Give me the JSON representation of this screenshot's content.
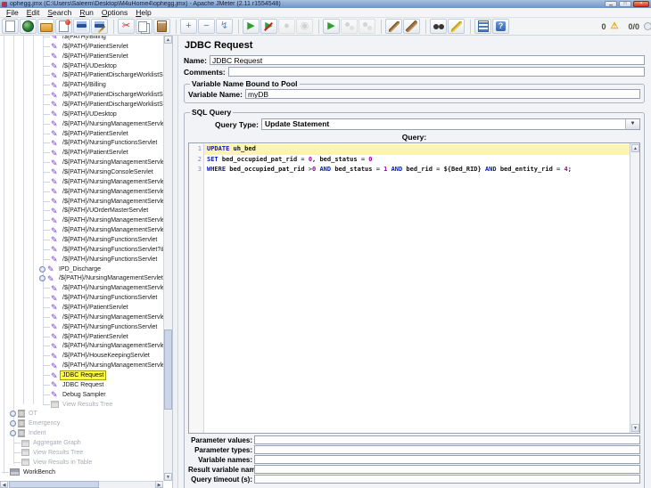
{
  "window": {
    "title": "ophegg.jmx (C:\\Users\\Saleem\\Desktop\\M4uHome4\\ophegg.jmx) - Apache JMeter (2.11 r1554548)",
    "controls": [
      {
        "name": "minimize",
        "glyph": "▁"
      },
      {
        "name": "maximize",
        "glyph": "□"
      },
      {
        "name": "close",
        "glyph": "×"
      }
    ]
  },
  "menu": {
    "items": [
      "File",
      "Edit",
      "Search",
      "Run",
      "Options",
      "Help"
    ]
  },
  "toolbar": {
    "groups": [
      [
        {
          "name": "new-file"
        },
        {
          "name": "templates"
        },
        {
          "name": "open-folder"
        },
        {
          "name": "close-file"
        },
        {
          "name": "save"
        },
        {
          "name": "save-as"
        }
      ],
      [
        {
          "name": "cut",
          "glyph": "✂",
          "color": "#cc2020"
        },
        {
          "name": "copy"
        },
        {
          "name": "paste"
        }
      ],
      [
        {
          "name": "expand-all",
          "glyph": "+",
          "color": "#4878c8"
        },
        {
          "name": "collapse-all",
          "glyph": "−",
          "color": "#4878c8"
        },
        {
          "name": "toggle",
          "glyph": "↯",
          "color": "#6888c8"
        }
      ],
      [
        {
          "name": "start",
          "glyph": "▶",
          "color": "#2ca02c"
        },
        {
          "name": "start-no-pauses",
          "glyph": "▶",
          "color": "#2ca02c"
        },
        {
          "name": "stop",
          "glyph": "●",
          "color": "#b0b0b0",
          "disabled": true
        },
        {
          "name": "shutdown",
          "glyph": "◉",
          "color": "#b0b0b0",
          "disabled": true
        }
      ],
      [
        {
          "name": "remote-start",
          "glyph": "▶",
          "color": "#2ca02c"
        },
        {
          "name": "remote-start-all",
          "disabled": true
        },
        {
          "name": "remote-stop",
          "disabled": true
        }
      ],
      [
        {
          "name": "clear"
        },
        {
          "name": "clear-all"
        }
      ],
      [
        {
          "name": "search"
        },
        {
          "name": "search-reset"
        }
      ],
      [
        {
          "name": "function-helper"
        },
        {
          "name": "help"
        }
      ]
    ],
    "status": {
      "errors": "0",
      "warn_icon": "⚠",
      "threads": "0/0"
    }
  },
  "tree": {
    "items": [
      {
        "label": "/${PATH}/Billing",
        "type": "sampler",
        "indent": 57
      },
      {
        "label": "/${PATH}/PatientServlet",
        "type": "sampler",
        "indent": 57
      },
      {
        "label": "/${PATH}/PatientServlet",
        "type": "sampler",
        "indent": 57
      },
      {
        "label": "/${PATH}/UDesktop",
        "type": "sampler",
        "indent": 57
      },
      {
        "label": "/${PATH}/PatientDischargeWorklistServlet",
        "type": "sampler",
        "indent": 57
      },
      {
        "label": "/${PATH}/Billing",
        "type": "sampler",
        "indent": 57
      },
      {
        "label": "/${PATH}/PatientDischargeWorklistServlet",
        "type": "sampler",
        "indent": 57
      },
      {
        "label": "/${PATH}/PatientDischargeWorklistServlet",
        "type": "sampler",
        "indent": 57
      },
      {
        "label": "/${PATH}/UDesktop",
        "type": "sampler",
        "indent": 57
      },
      {
        "label": "/${PATH}/NursingManagementServlet",
        "type": "sampler",
        "indent": 57
      },
      {
        "label": "/${PATH}/PatientServlet",
        "type": "sampler",
        "indent": 57
      },
      {
        "label": "/${PATH}/NursingFunctionsServlet",
        "type": "sampler",
        "indent": 57
      },
      {
        "label": "/${PATH}/PatientServlet",
        "type": "sampler",
        "indent": 57
      },
      {
        "label": "/${PATH}/NursingManagementServlet",
        "type": "sampler",
        "indent": 57
      },
      {
        "label": "/${PATH}/NursingConsoleServlet",
        "type": "sampler",
        "indent": 57
      },
      {
        "label": "/${PATH}/NursingManagementServlet",
        "type": "sampler",
        "indent": 57
      },
      {
        "label": "/${PATH}/NursingManagementServlet",
        "type": "sampler",
        "indent": 57
      },
      {
        "label": "/${PATH}/NursingManagementServlet",
        "type": "sampler",
        "indent": 57
      },
      {
        "label": "/${PATH}/UOrderMasterServlet",
        "type": "sampler",
        "indent": 57
      },
      {
        "label": "/${PATH}/NursingManagementServlet",
        "type": "sampler",
        "indent": 57
      },
      {
        "label": "/${PATH}/NursingManagementServlet",
        "type": "sampler",
        "indent": 57
      },
      {
        "label": "/${PATH}/NursingFunctionsServlet",
        "type": "sampler",
        "indent": 57
      },
      {
        "label": "/${PATH}/NursingFunctionsServlet?&use",
        "type": "sampler",
        "indent": 57
      },
      {
        "label": "/${PATH}/NursingFunctionsServlet",
        "type": "sampler",
        "indent": 57
      },
      {
        "label": "IPD_Discharge",
        "type": "sampler",
        "indent": 57,
        "handle": true
      },
      {
        "label": "/${PATH}/NursingManagementServlet",
        "type": "sampler",
        "indent": 57,
        "handle": true
      },
      {
        "label": "/${PATH}/NursingManagementServlet",
        "type": "sampler",
        "indent": 57
      },
      {
        "label": "/${PATH}/NursingFunctionsServlet",
        "type": "sampler",
        "indent": 57
      },
      {
        "label": "/${PATH}/PatientServlet",
        "type": "sampler",
        "indent": 57
      },
      {
        "label": "/${PATH}/NursingManagementServlet",
        "type": "sampler",
        "indent": 57
      },
      {
        "label": "/${PATH}/NursingFunctionsServlet",
        "type": "sampler",
        "indent": 57
      },
      {
        "label": "/${PATH}/PatientServlet",
        "type": "sampler",
        "indent": 57
      },
      {
        "label": "/${PATH}/NursingManagementServlet",
        "type": "sampler",
        "indent": 57
      },
      {
        "label": "/${PATH}/HouseKeepingServlet",
        "type": "sampler",
        "indent": 57
      },
      {
        "label": "/${PATH}/NursingManagementServlet",
        "type": "sampler",
        "indent": 57
      },
      {
        "label": "JDBC Request",
        "type": "sampler",
        "indent": 57,
        "selected": true
      },
      {
        "label": "JDBC Request",
        "type": "sampler",
        "indent": 57
      },
      {
        "label": "Debug Sampler",
        "type": "sampler",
        "indent": 57
      },
      {
        "label": "View Results Tree",
        "type": "listener",
        "indent": 57,
        "disabled": true
      },
      {
        "label": "OT",
        "type": "threadgroup",
        "indent": 24,
        "handle": true,
        "disabled": true
      },
      {
        "label": "Emergency",
        "type": "threadgroup",
        "indent": 24,
        "handle": true,
        "disabled": true
      },
      {
        "label": "Indent",
        "type": "threadgroup",
        "indent": 24,
        "handle": true,
        "disabled": true
      },
      {
        "label": "Aggregate Graph",
        "type": "listener",
        "indent": 24,
        "disabled": true
      },
      {
        "label": "View Results Tree",
        "type": "listener",
        "indent": 24,
        "disabled": true
      },
      {
        "label": "View Results in Table",
        "type": "listener",
        "indent": 24,
        "disabled": true
      },
      {
        "label": "WorkBench",
        "type": "workbench",
        "indent": 11
      }
    ]
  },
  "panel": {
    "title": "JDBC Request",
    "name_label": "Name:",
    "name_value": "JDBC Request",
    "comments_label": "Comments:",
    "comments_value": "",
    "pool_group": {
      "title": "Variable Name Bound to Pool",
      "var_label": "Variable Name:",
      "var_value": "myDB"
    },
    "sql_group": {
      "title": "SQL Query",
      "query_type_label": "Query Type:",
      "query_type_value": "Update Statement",
      "query_label": "Query:",
      "syntax_colors": {
        "keyword": "#0018c8",
        "number": "#a000a0",
        "plain": "#101010"
      },
      "active_line_color": "#fcf5b2",
      "sql_lines": [
        {
          "num": 1,
          "active": true,
          "tokens": [
            [
              "kw",
              "UPDATE"
            ],
            [
              "pl",
              " uh_bed"
            ]
          ]
        },
        {
          "num": 2,
          "tokens": [
            [
              "kw",
              "SET"
            ],
            [
              "pl",
              " bed_occupied_pat_rid "
            ],
            [
              "op",
              "="
            ],
            [
              "pl",
              " "
            ],
            [
              "num",
              "0"
            ],
            [
              "pl",
              ", bed_status "
            ],
            [
              "op",
              "="
            ],
            [
              "pl",
              " "
            ],
            [
              "num",
              "0"
            ]
          ]
        },
        {
          "num": 3,
          "tokens": [
            [
              "kw",
              "WHERE"
            ],
            [
              "pl",
              " bed_occupied_pat_rid "
            ],
            [
              "op",
              ">"
            ],
            [
              "num",
              "0"
            ],
            [
              "pl",
              " "
            ],
            [
              "kw",
              "AND"
            ],
            [
              "pl",
              " bed_status "
            ],
            [
              "op",
              "="
            ],
            [
              "pl",
              " "
            ],
            [
              "num",
              "1"
            ],
            [
              "pl",
              " "
            ],
            [
              "kw",
              "AND"
            ],
            [
              "pl",
              " bed_rid "
            ],
            [
              "op",
              "="
            ],
            [
              "pl",
              " ${Bed_RID} "
            ],
            [
              "kw",
              "AND"
            ],
            [
              "pl",
              " bed_entity_rid "
            ],
            [
              "op",
              "="
            ],
            [
              "pl",
              " "
            ],
            [
              "num",
              "4"
            ],
            [
              "pl",
              ";"
            ]
          ]
        }
      ],
      "fields": [
        {
          "label": "Parameter values:",
          "value": ""
        },
        {
          "label": "Parameter types:",
          "value": ""
        },
        {
          "label": "Variable names:",
          "value": ""
        },
        {
          "label": "Result variable name:",
          "value": ""
        },
        {
          "label": "Query timeout (s):",
          "value": ""
        }
      ]
    }
  }
}
